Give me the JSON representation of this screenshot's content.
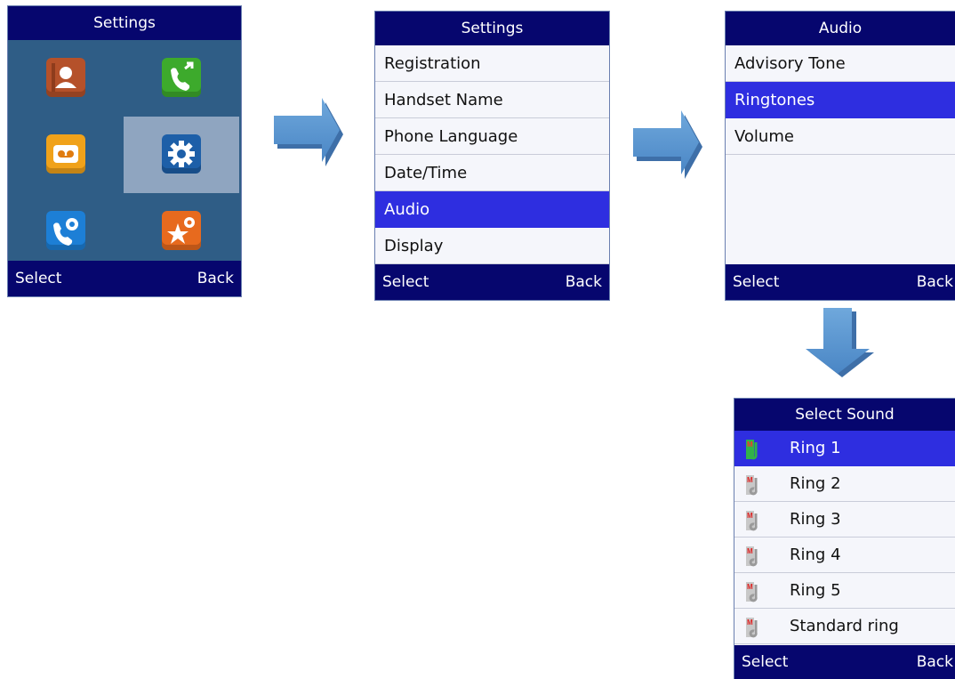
{
  "screen1": {
    "title": "Settings",
    "softkey_left": "Select",
    "softkey_right": "Back",
    "icons": [
      {
        "icon": "phonebook-icon",
        "color": "#b5512a"
      },
      {
        "icon": "call-history-icon",
        "color": "#3daa2c"
      },
      {
        "icon": "voicemail-icon",
        "color": "#f0a21a"
      },
      {
        "icon": "settings-gear-icon",
        "color": "#1d5fa8",
        "selected": true
      },
      {
        "icon": "call-settings-icon",
        "color": "#1d7fd6"
      },
      {
        "icon": "feature-star-icon",
        "color": "#e76a1e"
      }
    ]
  },
  "screen2": {
    "title": "Settings",
    "items": [
      "Registration",
      "Handset Name",
      "Phone Language",
      "Date/Time",
      "Audio",
      "Display"
    ],
    "selected": "Audio",
    "softkey_left": "Select",
    "softkey_right": "Back"
  },
  "screen3": {
    "title": "Audio",
    "items": [
      "Advisory Tone",
      "Ringtones",
      "Volume"
    ],
    "selected": "Ringtones",
    "softkey_left": "Select",
    "softkey_right": "Back"
  },
  "screen4": {
    "title": "Select Sound",
    "items": [
      "Ring 1",
      "Ring 2",
      "Ring 3",
      "Ring 4",
      "Ring 5",
      "Standard ring"
    ],
    "selected": "Ring 1",
    "softkey_left": "Select",
    "softkey_right": "Back"
  },
  "colors": {
    "bar": "#06066e",
    "highlight": "#2e2ee0",
    "grid_bg": "#2f5d86",
    "arrow": "#5b9bd5"
  }
}
